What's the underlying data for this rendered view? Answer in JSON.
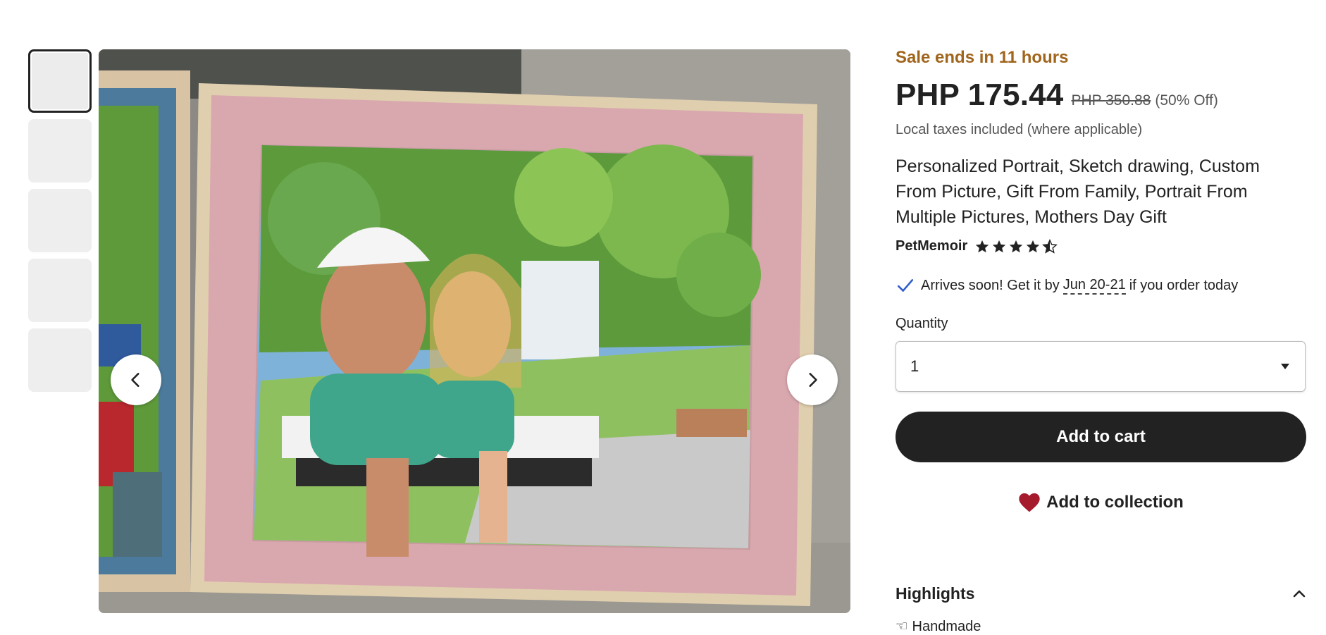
{
  "gallery": {
    "thumbnail_count": 5,
    "active_index": 0,
    "prev_icon": "chevron-left-icon",
    "next_icon": "chevron-right-icon"
  },
  "listing": {
    "sale_text": "Sale ends in 11 hours",
    "price": "PHP 175.44",
    "original_price": "PHP 350.88",
    "discount": "(50% Off)",
    "taxes_note": "Local taxes included (where applicable)",
    "title": "Personalized Portrait, Sketch drawing, Custom From Picture, Gift From Family, Portrait From Multiple Pictures, Mothers Day Gift",
    "shop_name": "PetMemoir",
    "rating": 4.5,
    "rating_max": 5,
    "arrival_prefix": "Arrives soon! Get it by",
    "arrival_date": "Jun 20-21",
    "arrival_suffix": "if you order today",
    "quantity_label": "Quantity",
    "quantity_value": "1",
    "add_to_cart": "Add to cart",
    "add_to_collection": "Add to collection",
    "highlights_label": "Highlights",
    "highlights_peek": "Handmade"
  },
  "colors": {
    "sale": "#a0651d",
    "button_dark": "#222222",
    "heart": "#a61a2e",
    "check": "#2f5dcc"
  }
}
